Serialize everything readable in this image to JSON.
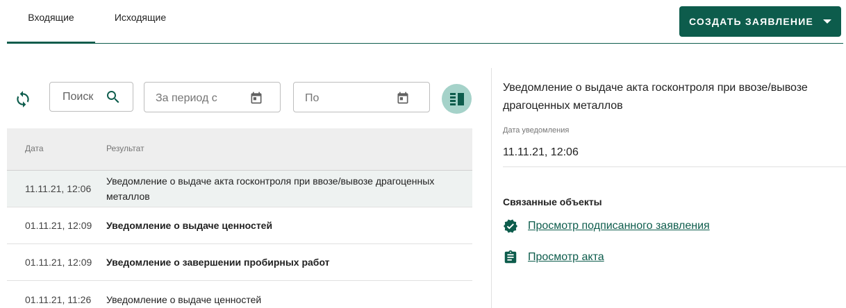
{
  "tabs": [
    {
      "label": "Входящие",
      "active": true
    },
    {
      "label": "Исходящие",
      "active": false
    }
  ],
  "create_button": {
    "label": "СОЗДАТЬ ЗАЯВЛЕНИЕ"
  },
  "toolbar": {
    "search_placeholder": "Поиск",
    "date_from_placeholder": "За период с",
    "date_to_placeholder": "По"
  },
  "table": {
    "headers": {
      "date": "Дата",
      "result": "Результат"
    },
    "rows": [
      {
        "date": "11.11.21, 12:06",
        "result": "Уведомление о выдаче акта госконтроля при ввозе/вывозе драгоценных металлов",
        "bold": false,
        "selected": true
      },
      {
        "date": "01.11.21, 12:09",
        "result": "Уведомление о выдаче ценностей",
        "bold": true,
        "selected": false
      },
      {
        "date": "01.11.21, 12:09",
        "result": "Уведомление о завершении пробирных работ",
        "bold": true,
        "selected": false
      },
      {
        "date": "01.11.21, 11:26",
        "result": "Уведомление о выдаче ценностей",
        "bold": false,
        "selected": false
      }
    ]
  },
  "details": {
    "title": "Уведомление о выдаче акта госконтроля при ввозе/вывозе драгоценных металлов",
    "date_label": "Дата уведомления",
    "date_value": "11.11.21, 12:06",
    "related_label": "Связанные объекты",
    "links": [
      {
        "label": "Просмотр подписанного заявления",
        "icon": "verified-badge-icon"
      },
      {
        "label": "Просмотр акта",
        "icon": "clipboard-icon"
      }
    ]
  },
  "colors": {
    "accent": "#0d5c4c",
    "toggle_bg": "#a5d2c9",
    "selected_row": "#eef2f1",
    "header_bg": "#eeeeee"
  }
}
